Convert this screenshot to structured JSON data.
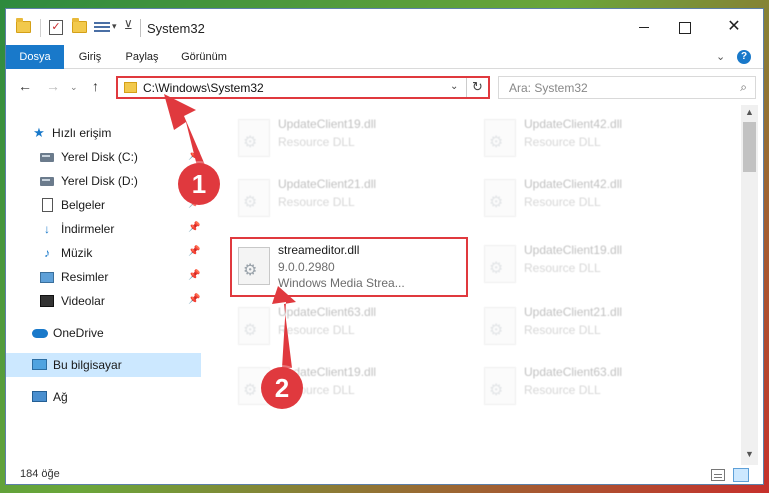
{
  "window": {
    "title": "System32"
  },
  "ribbon": {
    "tabs": [
      {
        "label": "Dosya"
      },
      {
        "label": "Giriş"
      },
      {
        "label": "Paylaş"
      },
      {
        "label": "Görünüm"
      }
    ],
    "help": "?"
  },
  "nav": {
    "address": "C:\\Windows\\System32",
    "search_placeholder": "Ara: System32"
  },
  "sidebar": {
    "items": [
      {
        "label": "Hızlı erişim"
      },
      {
        "label": "Yerel Disk (C:)"
      },
      {
        "label": "Yerel Disk (D:)"
      },
      {
        "label": "Belgeler"
      },
      {
        "label": "İndirmeler"
      },
      {
        "label": "Müzik"
      },
      {
        "label": "Resimler"
      },
      {
        "label": "Videolar"
      },
      {
        "label": "OneDrive"
      },
      {
        "label": "Bu bilgisayar"
      },
      {
        "label": "Ağ"
      }
    ]
  },
  "files": [
    {
      "name": "UpdateClient19.dll",
      "type": "Resource DLL"
    },
    {
      "name": "UpdateClient42.dll",
      "type": "Resource DLL"
    },
    {
      "name": "UpdateClient21.dll",
      "type": "Resource DLL"
    },
    {
      "name": "UpdateClient42.dll",
      "type": "Resource DLL"
    },
    {
      "name": "streameditor.dll",
      "version": "9.0.0.2980",
      "description": "Windows Media Strea..."
    },
    {
      "name": "UpdateClient19.dll",
      "type": "Resource DLL"
    },
    {
      "name": "UpdateClient63.dll",
      "type": "Resource DLL"
    },
    {
      "name": "UpdateClient21.dll",
      "type": "Resource DLL"
    },
    {
      "name": "UpdateClient19.dll",
      "type": "Resource DLL"
    },
    {
      "name": "UpdateClient63.dll",
      "type": "Resource DLL"
    }
  ],
  "status": {
    "count": "184 öğe"
  },
  "annotations": {
    "step1": "1",
    "step2": "2",
    "color": "#e0393e"
  }
}
